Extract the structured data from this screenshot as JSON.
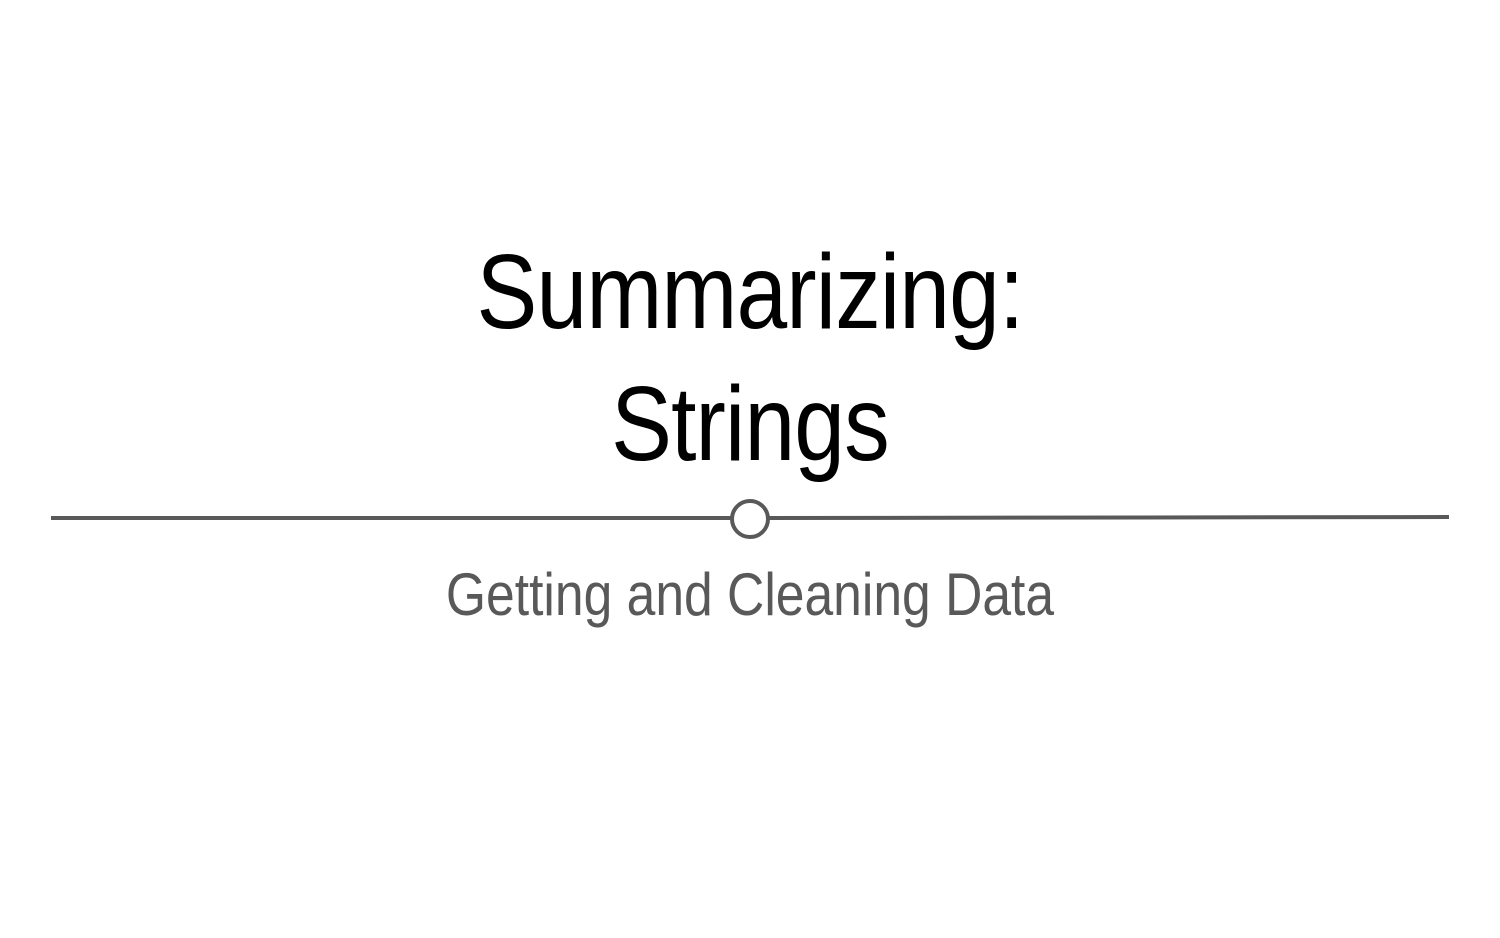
{
  "slide": {
    "title_lines": [
      "Summarizing:",
      "Strings"
    ],
    "subtitle": "Getting and Cleaning Data"
  },
  "colors": {
    "title": "#000000",
    "subtitle": "#595959",
    "divider": "#595959",
    "background": "#ffffff"
  }
}
